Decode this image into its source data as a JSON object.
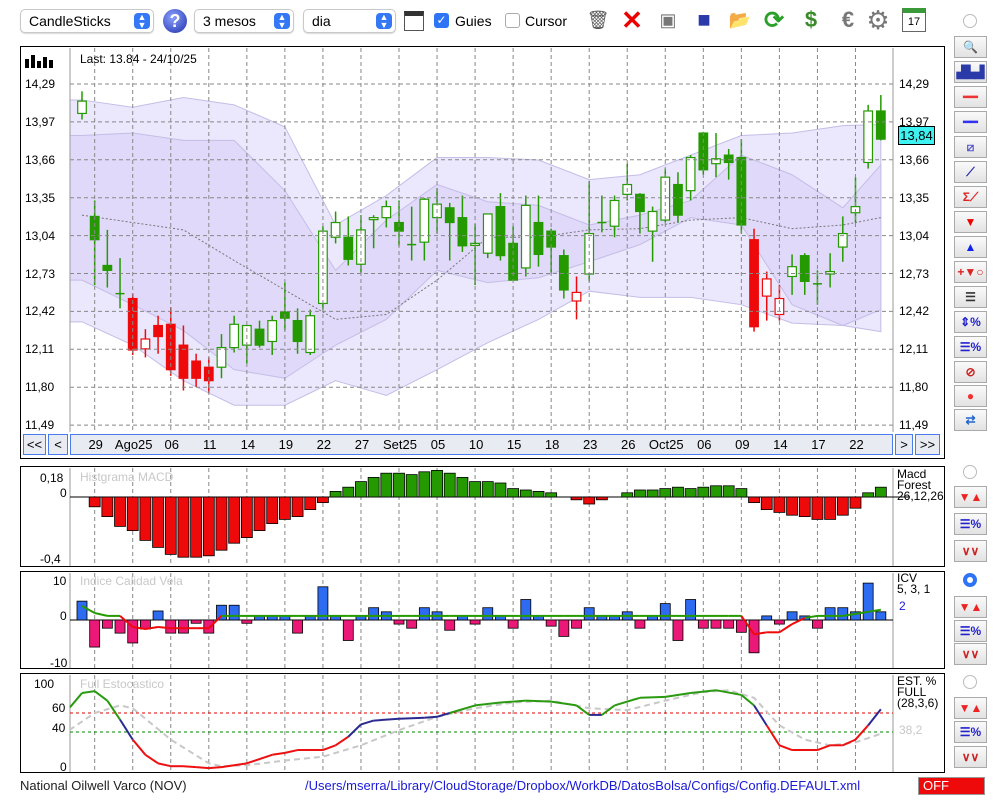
{
  "toolbar": {
    "chart_type": "CandleSticks",
    "period": "3 mesos",
    "interval": "dia",
    "guies_label": "Guies",
    "guies_checked": true,
    "cursor_label": "Cursor",
    "cursor_checked": false,
    "icons": [
      "trash-icon",
      "delete-icon",
      "clear-icon",
      "save-icon",
      "folder-open-icon",
      "refresh-icon",
      "sync-icon",
      "euro-icon",
      "gear-icon",
      "calendar-icon"
    ],
    "calendar_day": "17"
  },
  "main": {
    "last_label": "Last: 13.84 - 24/10/25",
    "price_ticks": [
      "14,29",
      "13,97",
      "13,66",
      "13,35",
      "13,04",
      "12,73",
      "12,42",
      "12,11",
      "11,80",
      "11,49"
    ],
    "current_price": "13,84",
    "current_price_color": "#3ef2f2",
    "nav": {
      "first": "<<",
      "prev": "<",
      "next": ">",
      "last": ">>"
    }
  },
  "chart_data": [
    {
      "type": "candlestick",
      "title": "Last: 13.84 - 24/10/25",
      "ylim": [
        11.49,
        14.29
      ],
      "x_tick_labels": [
        {
          "i": 1,
          "t": "29"
        },
        {
          "i": 4,
          "t": "Ago25"
        },
        {
          "i": 7,
          "t": "06"
        },
        {
          "i": 10,
          "t": "11"
        },
        {
          "i": 13,
          "t": "14"
        },
        {
          "i": 16,
          "t": "19"
        },
        {
          "i": 19,
          "t": "22"
        },
        {
          "i": 22,
          "t": "27"
        },
        {
          "i": 25,
          "t": "Set25"
        },
        {
          "i": 28,
          "t": "05"
        },
        {
          "i": 31,
          "t": "10"
        },
        {
          "i": 34,
          "t": "15"
        },
        {
          "i": 37,
          "t": "18"
        },
        {
          "i": 40,
          "t": "23"
        },
        {
          "i": 43,
          "t": "26"
        },
        {
          "i": 46,
          "t": "Oct25"
        },
        {
          "i": 49,
          "t": "06"
        },
        {
          "i": 52,
          "t": "09"
        },
        {
          "i": 55,
          "t": "14"
        },
        {
          "i": 58,
          "t": "17"
        },
        {
          "i": 61,
          "t": "22"
        }
      ],
      "ohlc_fields": [
        "open",
        "high",
        "low",
        "close",
        "signal"
      ],
      "candles": [
        [
          14.05,
          14.23,
          14.0,
          14.15,
          "g"
        ],
        [
          13.21,
          13.34,
          12.65,
          13.02,
          "g"
        ],
        [
          12.81,
          13.1,
          12.63,
          12.77,
          "g"
        ],
        [
          12.58,
          12.87,
          12.46,
          12.58,
          "g"
        ],
        [
          12.54,
          12.58,
          12.08,
          12.12,
          "r"
        ],
        [
          12.13,
          12.29,
          12.06,
          12.21,
          "r"
        ],
        [
          12.32,
          12.4,
          12.09,
          12.23,
          "r"
        ],
        [
          12.33,
          12.47,
          11.91,
          11.96,
          "r"
        ],
        [
          12.16,
          12.32,
          11.79,
          11.89,
          "r"
        ],
        [
          12.03,
          12.09,
          11.82,
          11.89,
          "r"
        ],
        [
          11.98,
          12.06,
          11.77,
          11.87,
          "r"
        ],
        [
          11.98,
          12.25,
          11.89,
          12.14,
          "g"
        ],
        [
          12.14,
          12.4,
          12.1,
          12.33,
          "g"
        ],
        [
          12.16,
          12.32,
          12.01,
          12.32,
          "g"
        ],
        [
          12.29,
          12.36,
          12.14,
          12.16,
          "g"
        ],
        [
          12.19,
          12.4,
          12.08,
          12.36,
          "g"
        ],
        [
          12.43,
          12.67,
          12.28,
          12.38,
          "g"
        ],
        [
          12.36,
          12.46,
          12.09,
          12.19,
          "g"
        ],
        [
          12.1,
          12.45,
          12.08,
          12.4,
          "g"
        ],
        [
          12.5,
          13.13,
          12.45,
          13.09,
          "g"
        ],
        [
          13.04,
          13.25,
          12.99,
          13.16,
          "g"
        ],
        [
          13.04,
          13.21,
          12.81,
          12.86,
          "g"
        ],
        [
          12.82,
          13.22,
          12.75,
          13.1,
          "g"
        ],
        [
          13.19,
          13.22,
          12.95,
          13.2,
          "g"
        ],
        [
          13.2,
          13.34,
          13.12,
          13.29,
          "g"
        ],
        [
          13.16,
          13.34,
          12.97,
          13.09,
          "g"
        ],
        [
          12.98,
          13.29,
          12.85,
          12.98,
          "g"
        ],
        [
          13.0,
          13.36,
          12.85,
          13.35,
          "g"
        ],
        [
          13.2,
          13.44,
          13.07,
          13.31,
          "g"
        ],
        [
          13.28,
          13.32,
          12.85,
          13.16,
          "g"
        ],
        [
          13.2,
          13.38,
          12.92,
          12.97,
          "g"
        ],
        [
          12.98,
          13.15,
          12.65,
          12.99,
          "g"
        ],
        [
          12.91,
          13.23,
          12.87,
          13.23,
          "g"
        ],
        [
          13.29,
          13.4,
          12.85,
          12.89,
          "g"
        ],
        [
          12.99,
          13.13,
          12.69,
          12.69,
          "g"
        ],
        [
          12.79,
          13.38,
          12.72,
          13.3,
          "g"
        ],
        [
          13.16,
          13.38,
          12.8,
          12.9,
          "g"
        ],
        [
          13.09,
          13.11,
          12.75,
          12.96,
          "g"
        ],
        [
          12.89,
          12.94,
          12.54,
          12.61,
          "g"
        ],
        [
          12.52,
          12.72,
          12.37,
          12.59,
          "r"
        ],
        [
          12.74,
          13.5,
          12.68,
          13.07,
          "g"
        ],
        [
          13.16,
          13.38,
          13.08,
          13.16,
          "g"
        ],
        [
          13.13,
          13.38,
          13.04,
          13.34,
          "g"
        ],
        [
          13.39,
          13.64,
          13.34,
          13.47,
          "g"
        ],
        [
          13.39,
          13.4,
          13.07,
          13.25,
          "g"
        ],
        [
          13.09,
          13.29,
          12.84,
          13.25,
          "g"
        ],
        [
          13.18,
          13.6,
          13.16,
          13.53,
          "g"
        ],
        [
          13.47,
          13.57,
          13.16,
          13.22,
          "g"
        ],
        [
          13.42,
          13.71,
          13.34,
          13.69,
          "g"
        ],
        [
          13.89,
          13.9,
          13.55,
          13.59,
          "g"
        ],
        [
          13.64,
          13.89,
          13.53,
          13.68,
          "g"
        ],
        [
          13.71,
          13.76,
          13.51,
          13.65,
          "g"
        ],
        [
          13.69,
          13.84,
          13.07,
          13.14,
          "g"
        ],
        [
          13.02,
          13.11,
          12.27,
          12.31,
          "r"
        ],
        [
          12.56,
          12.76,
          12.36,
          12.7,
          "r"
        ],
        [
          12.41,
          12.65,
          12.36,
          12.54,
          "r"
        ],
        [
          12.72,
          12.9,
          12.57,
          12.8,
          "g"
        ],
        [
          12.89,
          12.91,
          12.57,
          12.68,
          "g"
        ],
        [
          12.66,
          12.77,
          12.49,
          12.66,
          "g"
        ],
        [
          12.74,
          12.91,
          12.63,
          12.76,
          "g"
        ],
        [
          12.96,
          13.21,
          12.84,
          13.07,
          "g"
        ],
        [
          13.24,
          13.53,
          13.16,
          13.29,
          "g"
        ],
        [
          13.65,
          14.12,
          13.6,
          14.07,
          "g"
        ],
        [
          14.07,
          14.2,
          13.83,
          13.84,
          "g"
        ]
      ],
      "band_index": [
        0,
        4,
        8,
        12,
        16,
        20,
        24,
        28,
        32,
        36,
        40,
        44,
        48,
        52,
        56,
        60,
        63
      ],
      "outer_upper": [
        14.16,
        14.1,
        14.18,
        14.12,
        13.94,
        13.14,
        13.38,
        13.69,
        13.69,
        13.67,
        13.51,
        13.55,
        13.71,
        13.87,
        13.89,
        13.95,
        13.96
      ],
      "inner_upper": [
        13.87,
        13.89,
        13.83,
        13.83,
        13.42,
        12.77,
        13.18,
        13.47,
        13.33,
        13.3,
        13.14,
        13.22,
        13.34,
        13.71,
        13.55,
        13.28,
        13.63
      ],
      "moving_average": [
        13.22,
        13.16,
        13.1,
        12.85,
        12.61,
        12.37,
        12.41,
        12.69,
        13.04,
        13.04,
        13.1,
        13.11,
        13.18,
        13.2,
        13.11,
        13.14,
        13.2
      ],
      "inner_lower": [
        12.69,
        12.49,
        12.28,
        11.96,
        11.89,
        12.16,
        12.37,
        12.77,
        12.67,
        12.71,
        12.84,
        12.98,
        13.2,
        13.14,
        12.49,
        12.32,
        12.45
      ],
      "outer_lower": [
        12.35,
        12.16,
        11.87,
        11.67,
        11.67,
        11.87,
        11.75,
        11.96,
        12.18,
        12.37,
        12.6,
        12.55,
        12.55,
        12.49,
        12.34,
        12.32,
        12.27
      ]
    },
    {
      "type": "bar",
      "title": "Histgrama MACD",
      "ylim": [
        -0.4,
        0.18
      ],
      "y_ticks": [
        "0,18",
        "0",
        "-0,4"
      ],
      "legend": [
        "Macd",
        "Forest",
        "26,12,26"
      ],
      "values": [
        0,
        -0.07,
        -0.14,
        -0.21,
        -0.24,
        -0.31,
        -0.36,
        -0.41,
        -0.43,
        -0.43,
        -0.42,
        -0.38,
        -0.33,
        -0.29,
        -0.24,
        -0.19,
        -0.16,
        -0.14,
        -0.09,
        -0.04,
        0.04,
        0.07,
        0.11,
        0.14,
        0.17,
        0.17,
        0.16,
        0.18,
        0.19,
        0.17,
        0.14,
        0.11,
        0.11,
        0.1,
        0.06,
        0.05,
        0.04,
        0.03,
        0.0,
        -0.02,
        -0.05,
        -0.02,
        0.0,
        0.03,
        0.05,
        0.05,
        0.06,
        0.07,
        0.06,
        0.07,
        0.08,
        0.08,
        0.06,
        -0.04,
        -0.09,
        -0.11,
        -0.13,
        -0.14,
        -0.16,
        -0.16,
        -0.13,
        -0.08,
        0.03,
        0.07
      ]
    },
    {
      "type": "bar",
      "title": "Indice Calidad Vela",
      "ylim": [
        -10,
        10
      ],
      "y_ticks": [
        "10",
        "0",
        "-10"
      ],
      "legend": [
        "ICV",
        "5, 3, 1"
      ],
      "current": "2",
      "values": [
        4.6,
        -6.6,
        -2,
        -3.2,
        -5.6,
        -2.2,
        2.2,
        -3.2,
        -3.2,
        -0.8,
        -3.2,
        3.6,
        3.6,
        -0.8,
        1,
        1,
        1,
        -3.2,
        1,
        8.1,
        1,
        -5,
        1,
        3,
        2,
        -1,
        -2,
        3,
        2,
        -2.5,
        1,
        -1,
        3,
        1,
        -2,
        5,
        1,
        -1.5,
        -4,
        -2,
        3,
        1,
        1,
        2,
        -2,
        1,
        4,
        -5,
        5,
        -2,
        -2,
        -2,
        -3,
        -8,
        1,
        -1,
        2,
        1,
        -2,
        3,
        3,
        2,
        9,
        2
      ],
      "line": [
        3.4,
        1.7,
        1,
        1,
        -1.7,
        -2.2,
        -1.7,
        -2,
        -2,
        -2,
        -2,
        1,
        1,
        1,
        1,
        1,
        1,
        1,
        1,
        1,
        1,
        1,
        1,
        1,
        1,
        1,
        1,
        1,
        1,
        1,
        1,
        1,
        1,
        1,
        1,
        1,
        1,
        1,
        1,
        1,
        1,
        1,
        1,
        1,
        1,
        1,
        1,
        1,
        1,
        1,
        1,
        1,
        1,
        -3.5,
        -3,
        -3,
        -1,
        0.5,
        1,
        1,
        1,
        1.5,
        2,
        2.5
      ]
    },
    {
      "type": "line",
      "title": "Full Estocastico",
      "ylim": [
        0,
        100
      ],
      "y_ticks": [
        "100",
        "60",
        "40",
        "0"
      ],
      "levels": [
        60,
        40
      ],
      "legend": [
        "EST. %",
        "FULL",
        "(28,3,6)"
      ],
      "d_current": "38,2",
      "k": [
        [
          -1,
          66
        ],
        [
          0,
          81
        ],
        [
          1,
          83
        ],
        [
          2,
          73
        ],
        [
          3,
          53
        ],
        [
          4,
          32
        ],
        [
          5,
          16
        ],
        [
          6,
          7
        ],
        [
          7,
          4
        ],
        [
          8,
          4
        ],
        [
          9,
          3
        ],
        [
          10,
          2
        ],
        [
          11,
          3
        ],
        [
          13,
          7
        ],
        [
          15,
          16
        ],
        [
          16,
          18
        ],
        [
          17,
          21
        ],
        [
          19,
          21
        ],
        [
          20,
          26
        ],
        [
          21,
          35
        ],
        [
          22,
          48
        ],
        [
          23,
          52
        ],
        [
          25,
          54
        ],
        [
          27,
          55
        ],
        [
          28,
          56
        ],
        [
          29,
          60
        ],
        [
          31,
          68
        ],
        [
          33,
          71
        ],
        [
          35,
          73
        ],
        [
          37,
          72
        ],
        [
          39,
          68
        ],
        [
          40,
          58
        ],
        [
          41,
          58
        ],
        [
          42,
          68
        ],
        [
          44,
          76
        ],
        [
          46,
          77
        ],
        [
          48,
          81
        ],
        [
          50,
          84
        ],
        [
          52,
          79
        ],
        [
          53,
          68
        ],
        [
          54,
          47
        ],
        [
          55,
          26
        ],
        [
          56,
          21
        ],
        [
          58,
          21
        ],
        [
          59,
          26
        ],
        [
          60,
          26
        ],
        [
          61,
          32
        ],
        [
          62,
          47
        ],
        [
          63,
          64
        ]
      ],
      "d": [
        [
          -1,
          42
        ],
        [
          1,
          60
        ],
        [
          3,
          68
        ],
        [
          4,
          65
        ],
        [
          7,
          32
        ],
        [
          10,
          7
        ],
        [
          11,
          4
        ],
        [
          13,
          5
        ],
        [
          16,
          10
        ],
        [
          19,
          14
        ],
        [
          22,
          26
        ],
        [
          25,
          42
        ],
        [
          28,
          56
        ],
        [
          31,
          65
        ],
        [
          34,
          71
        ],
        [
          37,
          73
        ],
        [
          40,
          65
        ],
        [
          43,
          63
        ],
        [
          46,
          73
        ],
        [
          49,
          82
        ],
        [
          51,
          84
        ],
        [
          53,
          76
        ],
        [
          55,
          47
        ],
        [
          57,
          32
        ],
        [
          59,
          26
        ],
        [
          61,
          29
        ],
        [
          63,
          38.2
        ]
      ]
    }
  ],
  "side_toolbar": [
    "zoom-icon",
    "overview-chart-icon",
    "horizontal-red-line-icon",
    "horizontal-blue-line-icon",
    "channel-icon",
    "trendline-icon",
    "sigma-trendline-icon",
    "sell-arrow-icon",
    "buy-arrow-icon",
    "add-signal-icon",
    "grid-lines-icon",
    "height-percent-icon",
    "lines-percent-icon",
    "stop-icon",
    "record-icon",
    "swap-icon"
  ],
  "status": {
    "company": "National Oilwell Varco (NOV)",
    "config_path": "/Users/mserra/Library/CloudStorage/Dropbox/WorkDB/DatosBolsa/Configs/Config.DEFAULT.xml",
    "mode": "OFF"
  },
  "colors": {
    "green": "#259a00",
    "red": "#ee0a0a",
    "blue": "#2d6bf0",
    "pink": "#ec1877",
    "band_outer": "#ebe7fd",
    "band_inner": "#e0d9fa"
  }
}
